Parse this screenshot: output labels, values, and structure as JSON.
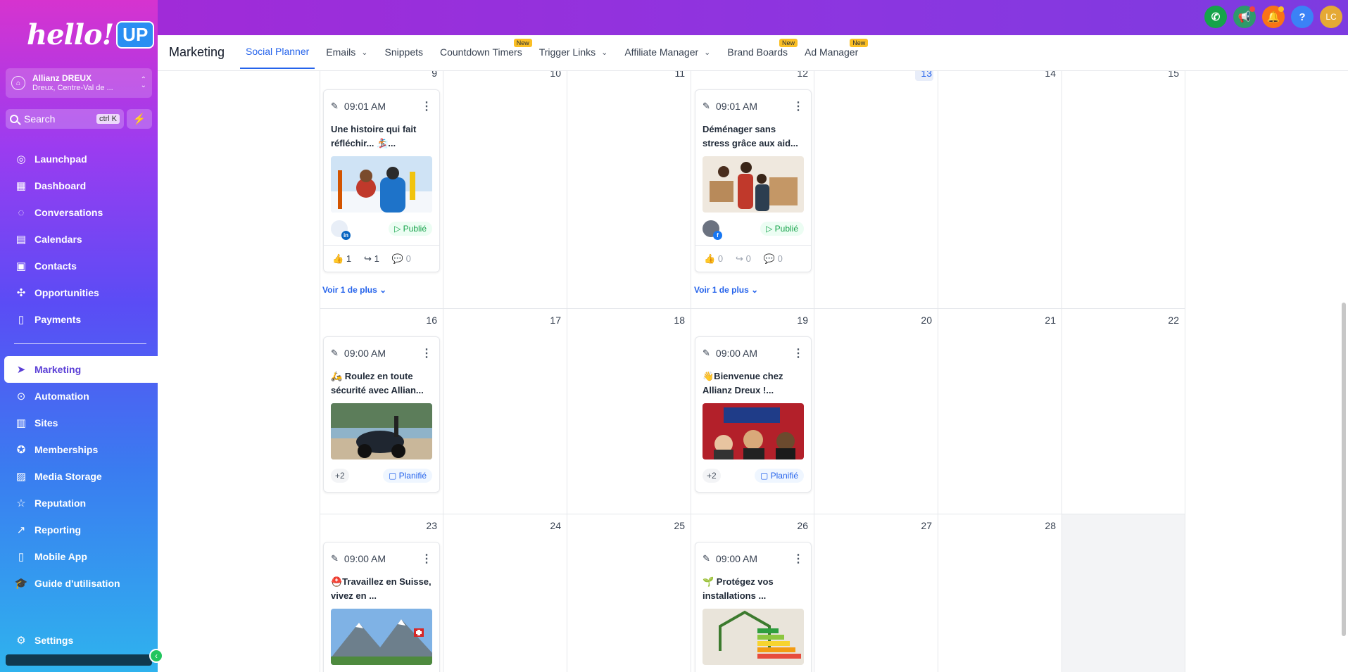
{
  "app": {
    "logo_text": "hello!",
    "logo_badge": "UP"
  },
  "account": {
    "name": "Allianz DREUX",
    "location": "Dreux, Centre-Val de ..."
  },
  "search": {
    "label": "Search",
    "shortcut": "ctrl K"
  },
  "sidebar": {
    "items": [
      {
        "label": "Launchpad",
        "icon": "launchpad-icon"
      },
      {
        "label": "Dashboard",
        "icon": "dashboard-icon"
      },
      {
        "label": "Conversations",
        "icon": "chat-icon"
      },
      {
        "label": "Calendars",
        "icon": "calendar-icon"
      },
      {
        "label": "Contacts",
        "icon": "contacts-icon"
      },
      {
        "label": "Opportunities",
        "icon": "opportunities-icon"
      },
      {
        "label": "Payments",
        "icon": "payments-icon"
      },
      {
        "label": "Marketing",
        "icon": "send-icon",
        "active": true
      },
      {
        "label": "Automation",
        "icon": "automation-icon"
      },
      {
        "label": "Sites",
        "icon": "sites-icon"
      },
      {
        "label": "Memberships",
        "icon": "memberships-icon"
      },
      {
        "label": "Media Storage",
        "icon": "media-icon"
      },
      {
        "label": "Reputation",
        "icon": "star-icon"
      },
      {
        "label": "Reporting",
        "icon": "reporting-icon"
      },
      {
        "label": "Mobile App",
        "icon": "mobile-icon"
      },
      {
        "label": "Guide d'utilisation",
        "icon": "graduation-cap-icon"
      }
    ],
    "settings_label": "Settings"
  },
  "topbar": {
    "icons": [
      {
        "name": "phone-icon",
        "color": "#16a34a"
      },
      {
        "name": "megaphone-icon",
        "color": "#2e9a6b"
      },
      {
        "name": "bell-icon",
        "color": "#f97316"
      },
      {
        "name": "help-icon",
        "color": "#3b82f6",
        "glyph": "?"
      },
      {
        "name": "user-avatar",
        "color": "#e5a935",
        "glyph": "LC"
      }
    ]
  },
  "subnav": {
    "title": "Marketing",
    "tabs": [
      {
        "label": "Social Planner",
        "active": true
      },
      {
        "label": "Emails",
        "dropdown": true
      },
      {
        "label": "Snippets"
      },
      {
        "label": "Countdown Timers",
        "new": "New"
      },
      {
        "label": "Trigger Links",
        "dropdown": true
      },
      {
        "label": "Affiliate Manager",
        "dropdown": true
      },
      {
        "label": "Brand Boards",
        "new": "New"
      },
      {
        "label": "Ad Manager",
        "new": "New"
      }
    ]
  },
  "calendar": {
    "weeks": [
      [
        "9",
        "10",
        "11",
        "12",
        "13",
        "14",
        "15"
      ],
      [
        "16",
        "17",
        "18",
        "19",
        "20",
        "21",
        "22"
      ],
      [
        "23",
        "24",
        "25",
        "26",
        "27",
        "28",
        ""
      ]
    ],
    "today": "13",
    "see_more_label": "Voir 1 de plus",
    "posts": [
      {
        "time": "09:01 AM",
        "text": "Une histoire qui fait réfléchir... 🏂...",
        "status": "Publié",
        "network": "in",
        "stats": {
          "likes": "1",
          "shares": "1",
          "comments": "0"
        }
      },
      {
        "time": "09:01 AM",
        "text": "Déménager sans stress grâce aux aid...",
        "status": "Publié",
        "network": "f",
        "stats": {
          "likes": "0",
          "shares": "0",
          "comments": "0"
        }
      },
      {
        "time": "09:00 AM",
        "text": "🛵 Roulez en toute sécurité avec Allian...",
        "status": "Planifié",
        "more": "+2"
      },
      {
        "time": "09:00 AM",
        "text": "👋Bienvenue chez Allianz Dreux !...",
        "status": "Planifié",
        "more": "+2"
      },
      {
        "time": "09:00 AM",
        "text": "⛑️Travaillez en Suisse, vivez en ...",
        "status": ""
      },
      {
        "time": "09:00 AM",
        "text": "🌱 Protégez vos installations ...",
        "status": ""
      }
    ]
  }
}
